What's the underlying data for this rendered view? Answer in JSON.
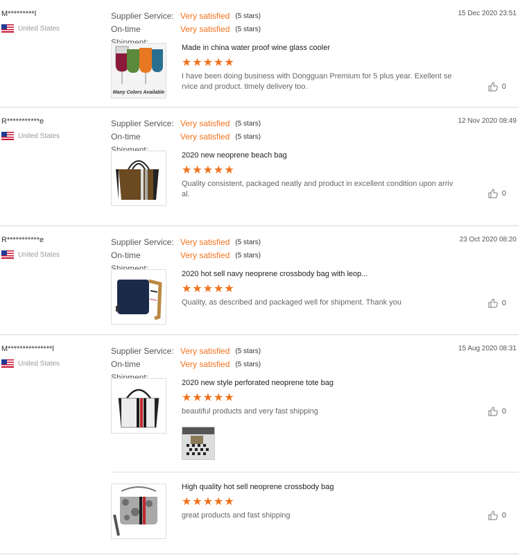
{
  "labels": {
    "supplier_service": "Supplier Service:",
    "ontime_shipment": "On-time Shipment:"
  },
  "colors": {
    "accent": "#f2711c",
    "divider": "#d8d8d8"
  },
  "reviews": [
    {
      "user": "M*********l",
      "country": "United States",
      "date": "15 Dec 2020 23:51",
      "supplier_service": "Very satisfied",
      "supplier_stars": "(5 stars)",
      "shipment": "Very satisfied",
      "shipment_stars": "(5 stars)",
      "products": [
        {
          "title": "Made in china water proof wine glass cooler",
          "stars": "★★★★★",
          "rating": 5,
          "comment": "I have been doing business with Dongguan Premium for 5 plus year. Exellent service and product. timely delivery too.",
          "likes": "0",
          "thumb_text": "Many Colors Available"
        }
      ]
    },
    {
      "user": "R***********e",
      "country": "United States",
      "date": "12 Nov 2020 08:49",
      "supplier_service": "Very satisfied",
      "supplier_stars": "(5 stars)",
      "shipment": "Very satisfied",
      "shipment_stars": "(5 stars)",
      "products": [
        {
          "title": "2020 new neoprene beach bag",
          "stars": "★★★★★",
          "rating": 5,
          "comment": "Quality consistent, packaged neatly and product in excellent condition upon arrival.",
          "likes": "0"
        }
      ]
    },
    {
      "user": "R***********e",
      "country": "United States",
      "date": "23 Oct 2020 08:20",
      "supplier_service": "Very satisfied",
      "supplier_stars": "(5 stars)",
      "shipment": "Very satisfied",
      "shipment_stars": "(5 stars)",
      "products": [
        {
          "title": "2020 hot sell navy neoprene crossbody bag with leop...",
          "stars": "★★★★★",
          "rating": 5,
          "comment": "Quality, as described and packaged well for shipment.  Thank you",
          "likes": "0"
        }
      ]
    },
    {
      "user": "M***************l",
      "country": "United States",
      "date": "15 Aug 2020 08:31",
      "supplier_service": "Very satisfied",
      "supplier_stars": "(5 stars)",
      "shipment": "Very satisfied",
      "shipment_stars": "(5 stars)",
      "products": [
        {
          "title": "2020 new style perforated neoprene tote bag",
          "stars": "★★★★★",
          "rating": 5,
          "comment": "beautiful products and very fast shipping",
          "likes": "0"
        },
        {
          "title": "High quality hot sell neoprene crossbody bag",
          "stars": "★★★★★",
          "rating": 5,
          "comment": "great products and fast shipping",
          "likes": "0"
        }
      ]
    }
  ]
}
